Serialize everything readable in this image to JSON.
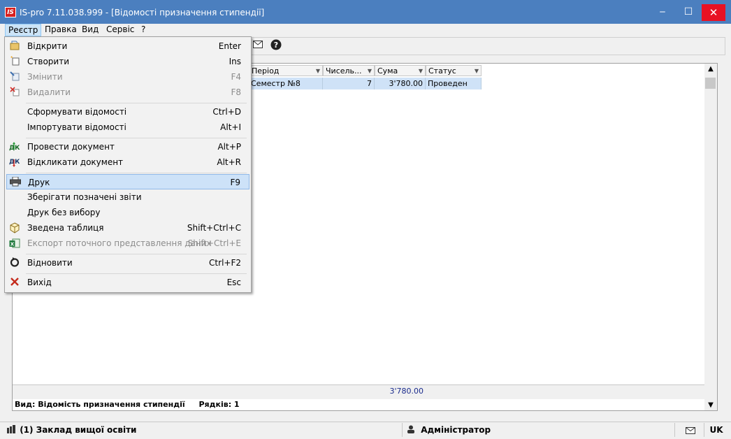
{
  "window": {
    "logo": "IS",
    "title": "IS-pro 7.11.038.999 - [Відомості призначення стипендії]",
    "minimize": "‒",
    "maximize": "☐",
    "close": "✕"
  },
  "menubar": [
    "Реєстр",
    "Правка",
    "Вид",
    "Сервіс",
    "?"
  ],
  "menu_items": [
    {
      "label": "Відкрити",
      "shortcut": "Enter",
      "icon": "open-icon"
    },
    {
      "label": "Створити",
      "shortcut": "Ins",
      "icon": "create-icon"
    },
    {
      "label": "Змінити",
      "shortcut": "F4",
      "icon": "edit-icon"
    },
    {
      "label": "Видалити",
      "shortcut": "F8",
      "icon": "delete-icon"
    },
    {
      "label": "Сформувати відомості",
      "shortcut": "Ctrl+D"
    },
    {
      "label": "Імпортувати відомості",
      "shortcut": "Alt+I"
    },
    {
      "label": "Провести документ",
      "shortcut": "Alt+P",
      "icon": "post-document-icon"
    },
    {
      "label": "Відкликати документ",
      "shortcut": "Alt+R",
      "icon": "recall-document-icon"
    },
    {
      "label": "Друк",
      "shortcut": "F9",
      "icon": "printer-icon"
    },
    {
      "label": "Зберігати позначені звіти",
      "shortcut": ""
    },
    {
      "label": "Друк без вибору",
      "shortcut": ""
    },
    {
      "label": "Зведена таблиця",
      "shortcut": "Shift+Ctrl+C",
      "icon": "pivot-table-icon"
    },
    {
      "label": "Експорт поточного представлення даних",
      "shortcut": "Shift+Ctrl+E",
      "icon": "excel-icon"
    },
    {
      "label": "Відновити",
      "shortcut": "Ctrl+F2",
      "icon": "refresh-icon"
    },
    {
      "label": "Вихід",
      "shortcut": "Esc",
      "icon": "exit-icon"
    }
  ],
  "grid": {
    "columns": [
      "Період",
      "Чисель...",
      "Сума",
      "Статус"
    ],
    "row": {
      "period": "Семестр  №8",
      "count": "7",
      "sum": "3'780.00",
      "status": "Проведен"
    },
    "total_sum": "3'780.00",
    "view_label": "Вид: Відомість призначення стипендії",
    "rows_label": "Рядків: 1"
  },
  "statusbar": {
    "org": "(1) Заклад вищої освіти",
    "user": "Адміністратор",
    "lang": "UK"
  },
  "colors": {
    "titlebar": "#4b7fbf",
    "close": "#e81123",
    "selection": "#cfe2f7"
  }
}
